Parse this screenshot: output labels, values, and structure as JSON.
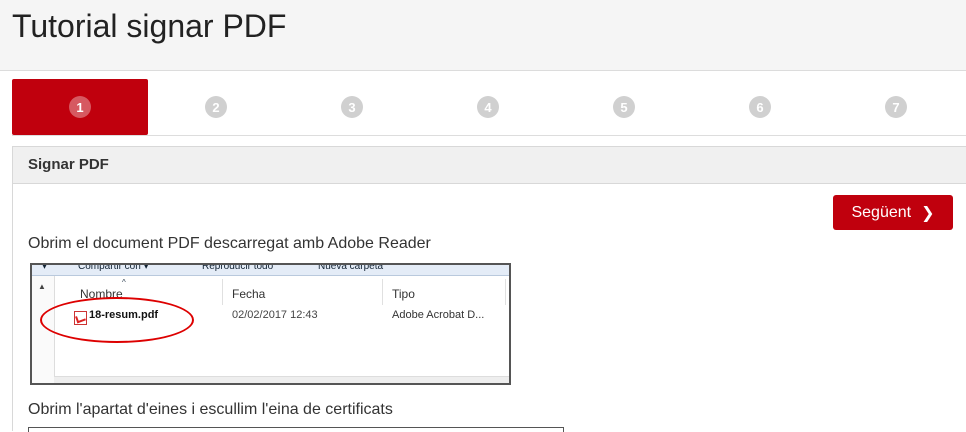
{
  "page": {
    "title": "Tutorial signar PDF"
  },
  "steps": [
    "1",
    "2",
    "3",
    "4",
    "5",
    "6",
    "7"
  ],
  "active_step": "1",
  "panel": {
    "heading": "Signar PDF",
    "next_label": "Següent",
    "instruction_1": "Obrim el document PDF descarregat amb Adobe Reader",
    "instruction_2": "Obrim l'apartat d'eines i escullim l'eina de certificats"
  },
  "explorer": {
    "toolbar": [
      "Compartir con ▾",
      "Reproducir todo",
      "Nueva carpeta"
    ],
    "columns": [
      "Nombre",
      "Fecha",
      "Tipo"
    ],
    "file": {
      "name": "18-resum.pdf",
      "date": "02/02/2017 12:43",
      "type": "Adobe Acrobat D..."
    }
  },
  "colors": {
    "accent": "#c0000d",
    "step_inactive": "#d0d0d0",
    "annotation": "#dd0000"
  }
}
